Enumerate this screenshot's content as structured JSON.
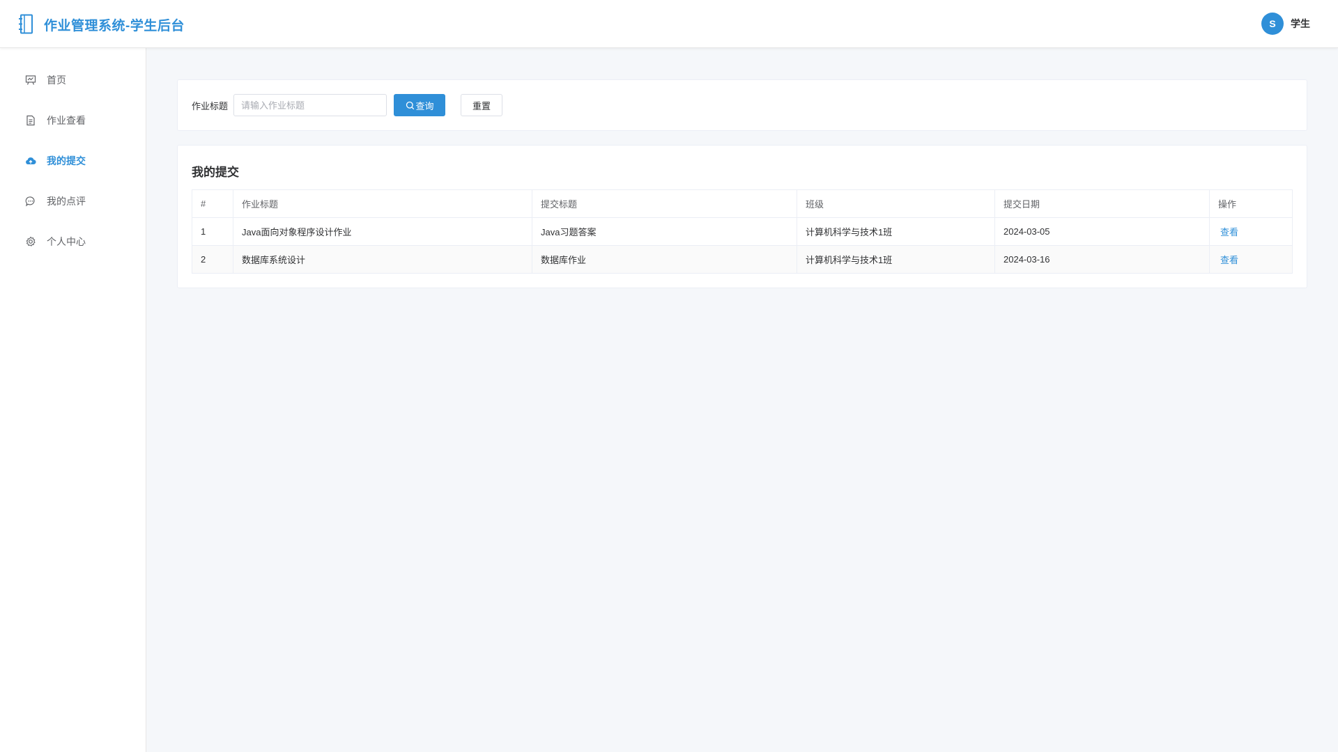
{
  "header": {
    "app_title": "作业管理系统-学生后台",
    "avatar_letter": "S",
    "user_name": "学生"
  },
  "sidebar": {
    "items": [
      {
        "label": "首页",
        "icon": "presentation-icon",
        "active": false
      },
      {
        "label": "作业查看",
        "icon": "document-icon",
        "active": false
      },
      {
        "label": "我的提交",
        "icon": "cloud-upload-icon",
        "active": true
      },
      {
        "label": "我的点评",
        "icon": "chat-bubble-icon",
        "active": false
      },
      {
        "label": "个人中心",
        "icon": "gear-icon",
        "active": false
      }
    ]
  },
  "search": {
    "label": "作业标题",
    "placeholder": "请输入作业标题",
    "value": "",
    "query_label": "查询",
    "reset_label": "重置"
  },
  "table": {
    "title": "我的提交",
    "headers": [
      "#",
      "作业标题",
      "提交标题",
      "班级",
      "提交日期",
      "操作"
    ],
    "rows": [
      {
        "index": "1",
        "homework_title": "Java面向对象程序设计作业",
        "submit_title": "Java习题答案",
        "class_name": "计算机科学与技术1班",
        "date": "2024-03-05",
        "action": "查看"
      },
      {
        "index": "2",
        "homework_title": "数据库系统设计",
        "submit_title": "数据库作业",
        "class_name": "计算机科学与技术1班",
        "date": "2024-03-16",
        "action": "查看"
      }
    ]
  },
  "colors": {
    "accent": "#2f8fd8",
    "background": "#f5f7fa"
  }
}
